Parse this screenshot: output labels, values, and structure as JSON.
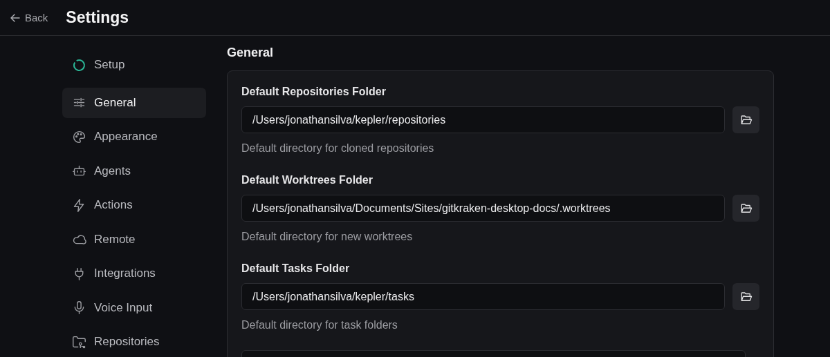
{
  "header": {
    "back": "Back",
    "title": "Settings"
  },
  "sidebar": {
    "items": [
      {
        "label": "Setup",
        "selected": false
      },
      {
        "label": "General",
        "selected": true
      },
      {
        "label": "Appearance",
        "selected": false
      },
      {
        "label": "Agents",
        "selected": false
      },
      {
        "label": "Actions",
        "selected": false
      },
      {
        "label": "Remote",
        "selected": false
      },
      {
        "label": "Integrations",
        "selected": false
      },
      {
        "label": "Voice Input",
        "selected": false
      },
      {
        "label": "Repositories",
        "selected": false
      }
    ]
  },
  "section": {
    "title": "General",
    "fields": [
      {
        "label": "Default Repositories Folder",
        "value": "/Users/jonathansilva/kepler/repositories",
        "help": "Default directory for cloned repositories"
      },
      {
        "label": "Default Worktrees Folder",
        "value": "/Users/jonathansilva/Documents/Sites/gitkraken-desktop-docs/.worktrees",
        "help": "Default directory for new worktrees"
      },
      {
        "label": "Default Tasks Folder",
        "value": "/Users/jonathansilva/kepler/tasks",
        "help": "Default directory for task folders"
      }
    ]
  }
}
